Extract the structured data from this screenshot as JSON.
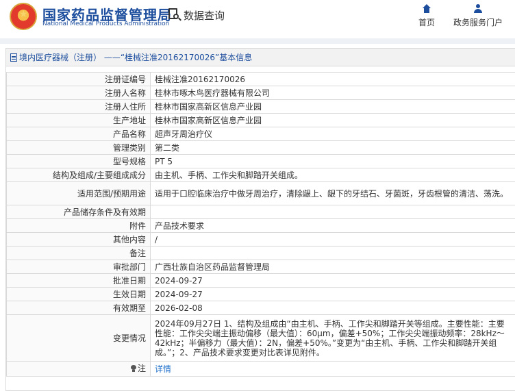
{
  "header": {
    "brand_cn": "国家药品监督管理局",
    "brand_en": "National Medical Products Administration",
    "search_label": "数据查询",
    "nav_home": "首页",
    "nav_portal": "政务服务门户",
    "colors": {
      "brand": "#1d4e9e",
      "link": "#1d6ecb",
      "border": "#d9d9d9"
    }
  },
  "panel": {
    "title": "境内医疗器械（注册） ——“桂械注准20162170026”基本信息"
  },
  "rows": [
    {
      "label": "注册证编号",
      "value": "桂械注准20162170026"
    },
    {
      "label": "注册人名称",
      "value": "桂林市啄木鸟医疗器械有限公司"
    },
    {
      "label": "注册人住所",
      "value": "桂林市国家高新区信息产业园"
    },
    {
      "label": "生产地址",
      "value": "桂林市国家高新区信息产业园"
    },
    {
      "label": "产品名称",
      "value": "超声牙周治疗仪"
    },
    {
      "label": "管理类别",
      "value": "第二类"
    },
    {
      "label": "型号规格",
      "value": "PT 5"
    },
    {
      "label": "结构及组成/主要组成成分",
      "value": "由主机、手柄、工作尖和脚踏开关组成。"
    },
    {
      "label": "适用范围/预期用途",
      "value": "适用于口腔临床治疗中做牙周治疗，清除龈上、龈下的牙结石、牙菌斑，牙齿根管的清洁、荡洗。"
    },
    {
      "label": "产品储存条件及有效期",
      "value": ""
    },
    {
      "label": "附件",
      "value": "产品技术要求"
    },
    {
      "label": "其他内容",
      "value": "/"
    },
    {
      "label": "备注",
      "value": ""
    },
    {
      "label": "审批部门",
      "value": "广西壮族自治区药品监督管理局"
    },
    {
      "label": "批准日期",
      "value": "2024-09-27"
    },
    {
      "label": "生效日期",
      "value": "2024-09-27"
    },
    {
      "label": "有效期至",
      "value": "2026-02-08"
    },
    {
      "label": "变更情况",
      "value": "2024年09月27日 1、结构及组成由“由主机、手柄、工作尖和脚踏开关等组成。主要性能：主要性能：工作尖尖端主振动偏移（最大值）：60μm，偏差+50%；工作尖尖端振动频率：28kHz～42kHz；半偏移力（最大值）：2N，偏差+50%。”变更为“由主机、手柄、工作尖和脚踏开关组成。”；2、产品技术要求变更对比表详见附件。"
    }
  ],
  "note": {
    "label": "注",
    "link": "详情"
  }
}
